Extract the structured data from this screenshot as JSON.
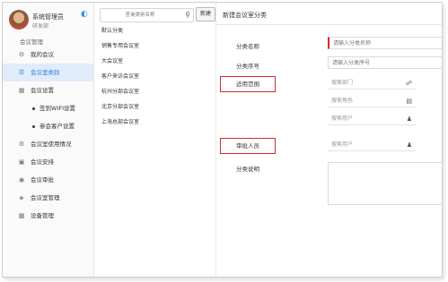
{
  "user": {
    "name": "系统管理员",
    "dept": "研发部"
  },
  "section_title": "会议管理",
  "nav": {
    "my_meetings": "我的会议",
    "room_category": "会议室类别",
    "meeting_settings": "会议设置",
    "sign_wifi": "签到WIFI设置",
    "attendee_settings": "参会客户设置",
    "room_usage": "会议室使用情况",
    "meeting_schedule": "会议安排",
    "meeting_approval": "会议审批",
    "room_management": "会议室管理",
    "device_management": "设备管理"
  },
  "search": {
    "placeholder": "查询类别名称"
  },
  "new_button": "新建",
  "categories": [
    "默认分类",
    "销售专用会议室",
    "大会议室",
    "客户来访会议室",
    "杭州分部会议室",
    "北京分部会议室",
    "上海总部会议室"
  ],
  "form": {
    "title": "新建会议室分类",
    "name_label": "分类名称",
    "name_placeholder": "请输入分类名称",
    "order_label": "分类序号",
    "order_placeholder": "请输入分类序号",
    "scope_label": "适用范围",
    "dept_placeholder": "搜索部门",
    "role_placeholder": "搜索角色",
    "user_placeholder": "搜索用户",
    "approver_label": "审批人员",
    "approver_placeholder": "搜索用户",
    "desc_label": "分类说明"
  }
}
